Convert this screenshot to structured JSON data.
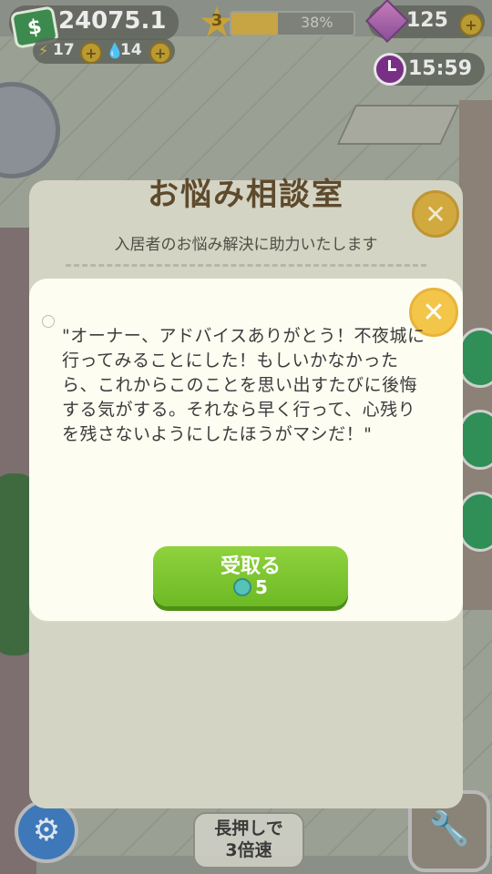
{
  "hud": {
    "money": "24075.1",
    "money_icon": "$",
    "energy": "17",
    "water": "14",
    "level": "3",
    "xp_percent_label": "38%",
    "xp_fraction": 0.38,
    "gems": "125",
    "time": "15:59"
  },
  "panel": {
    "title": "お悩み相談室",
    "subtitle": "入居者のお悩み解決に助力いたします"
  },
  "dialog": {
    "message": "\"オーナー、アドバイスありがとう！不夜城に行ってみることにした！もしいかなかったら、これからこのことを思い出すたびに後悔する気がする。それなら早く行って、心残りを残さないようにしたほうがマシだ！\"",
    "accept_label": "受取る",
    "reward_value": "5"
  },
  "controls": {
    "speed_label": "長押しで\n3倍速"
  },
  "icons": {
    "close": "✕",
    "plus": "+",
    "star": "★",
    "settings": "⚙",
    "build": "🔧",
    "bolt": "⚡",
    "drop": "💧"
  }
}
